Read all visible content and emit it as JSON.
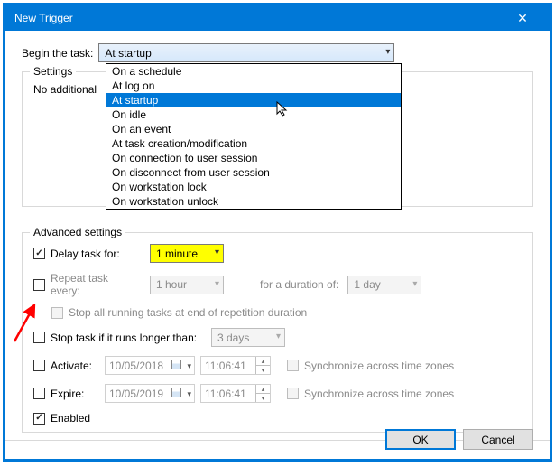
{
  "window": {
    "title": "New Trigger"
  },
  "begin": {
    "label": "Begin the task:",
    "selected": "At startup",
    "options": [
      "On a schedule",
      "At log on",
      "At startup",
      "On idle",
      "On an event",
      "At task creation/modification",
      "On connection to user session",
      "On disconnect from user session",
      "On workstation lock",
      "On workstation unlock"
    ],
    "highlighted_index": 2
  },
  "settings": {
    "legend": "Settings",
    "text": "No additional"
  },
  "advanced": {
    "legend": "Advanced settings",
    "delay": {
      "checked": true,
      "label": "Delay task for:",
      "value": "1 minute"
    },
    "repeat": {
      "checked": false,
      "label": "Repeat task every:",
      "value": "1 hour",
      "duration_label": "for a duration of:",
      "duration_value": "1 day",
      "stop_label": "Stop all running tasks at end of repetition duration",
      "stop_checked": false
    },
    "stoplong": {
      "checked": false,
      "label": "Stop task if it runs longer than:",
      "value": "3 days"
    },
    "activate": {
      "checked": false,
      "label": "Activate:",
      "date": "10/05/2018",
      "time": "11:06:41",
      "sync": "Synchronize across time zones",
      "sync_checked": false
    },
    "expire": {
      "checked": false,
      "label": "Expire:",
      "date": "10/05/2019",
      "time": "11:06:41",
      "sync": "Synchronize across time zones",
      "sync_checked": false
    },
    "enabled": {
      "checked": true,
      "label": "Enabled"
    }
  },
  "buttons": {
    "ok": "OK",
    "cancel": "Cancel"
  }
}
